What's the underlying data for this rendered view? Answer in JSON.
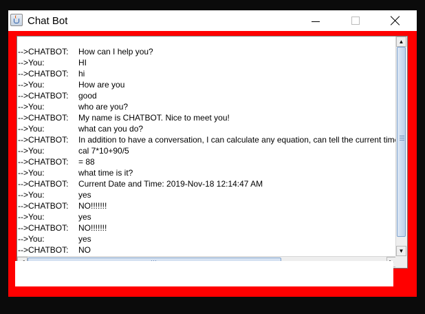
{
  "window": {
    "title": "Chat Bot"
  },
  "conversation": [
    {
      "speaker": "-->CHATBOT:",
      "message": "How can I help you?"
    },
    {
      "speaker": "-->You:",
      "message": "HI"
    },
    {
      "speaker": "-->CHATBOT:",
      "message": "hi"
    },
    {
      "speaker": "-->You:",
      "message": "How are you"
    },
    {
      "speaker": "-->CHATBOT:",
      "message": "good"
    },
    {
      "speaker": "-->You:",
      "message": "who are you?"
    },
    {
      "speaker": "-->CHATBOT:",
      "message": "My name is CHATBOT. Nice to meet you!"
    },
    {
      "speaker": "-->You:",
      "message": "what can you do?"
    },
    {
      "speaker": "-->CHATBOT:",
      "message": "In addition to have a conversation, I can calculate any equation, can tell the current time"
    },
    {
      "speaker": "-->You:",
      "message": "cal 7*10+90/5"
    },
    {
      "speaker": "-->CHATBOT:",
      "message": "= 88"
    },
    {
      "speaker": "-->You:",
      "message": "what time is it?"
    },
    {
      "speaker": "-->CHATBOT:",
      "message": "Current Date and Time:  2019-Nov-18 12:14:47 AM"
    },
    {
      "speaker": "-->You:",
      "message": "yes"
    },
    {
      "speaker": "-->CHATBOT:",
      "message": "NO!!!!!!!"
    },
    {
      "speaker": "-->You:",
      "message": "yes"
    },
    {
      "speaker": "-->CHATBOT:",
      "message": "NO!!!!!!!"
    },
    {
      "speaker": "-->You:",
      "message": "yes"
    },
    {
      "speaker": "-->CHATBOT:",
      "message": "NO"
    }
  ],
  "input": {
    "value": "",
    "placeholder": ""
  },
  "colors": {
    "frame": "#ff0000",
    "background": "#0b0b0b",
    "panel": "#ffffff"
  },
  "icons": [
    "java-app-icon",
    "minimize-icon",
    "maximize-icon",
    "close-icon",
    "scroll-up-arrow-icon",
    "scroll-down-arrow-icon",
    "scroll-left-arrow-icon",
    "scroll-right-arrow-icon"
  ]
}
